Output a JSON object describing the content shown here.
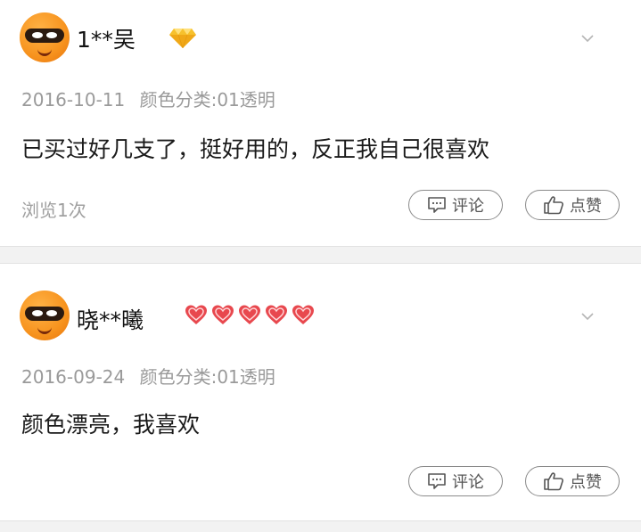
{
  "reviews": [
    {
      "username": "1**吴",
      "badge_icon": "diamond-icon",
      "date": "2016-10-11",
      "variant": "颜色分类:01透明",
      "text": "已买过好几支了，挺好用的，反正我自己很喜欢",
      "views": "浏览1次",
      "comment_label": "评论",
      "like_label": "点赞"
    },
    {
      "username": "晓**曦",
      "badge_icon": "five-hearts-icon",
      "date": "2016-09-24",
      "variant": "颜色分类:01透明",
      "text": "颜色漂亮，我喜欢",
      "comment_label": "评论",
      "like_label": "点赞"
    }
  ],
  "colors": {
    "diamond": "#f7c12d",
    "heart": "#e8484e",
    "avatar": "#f7931e"
  }
}
